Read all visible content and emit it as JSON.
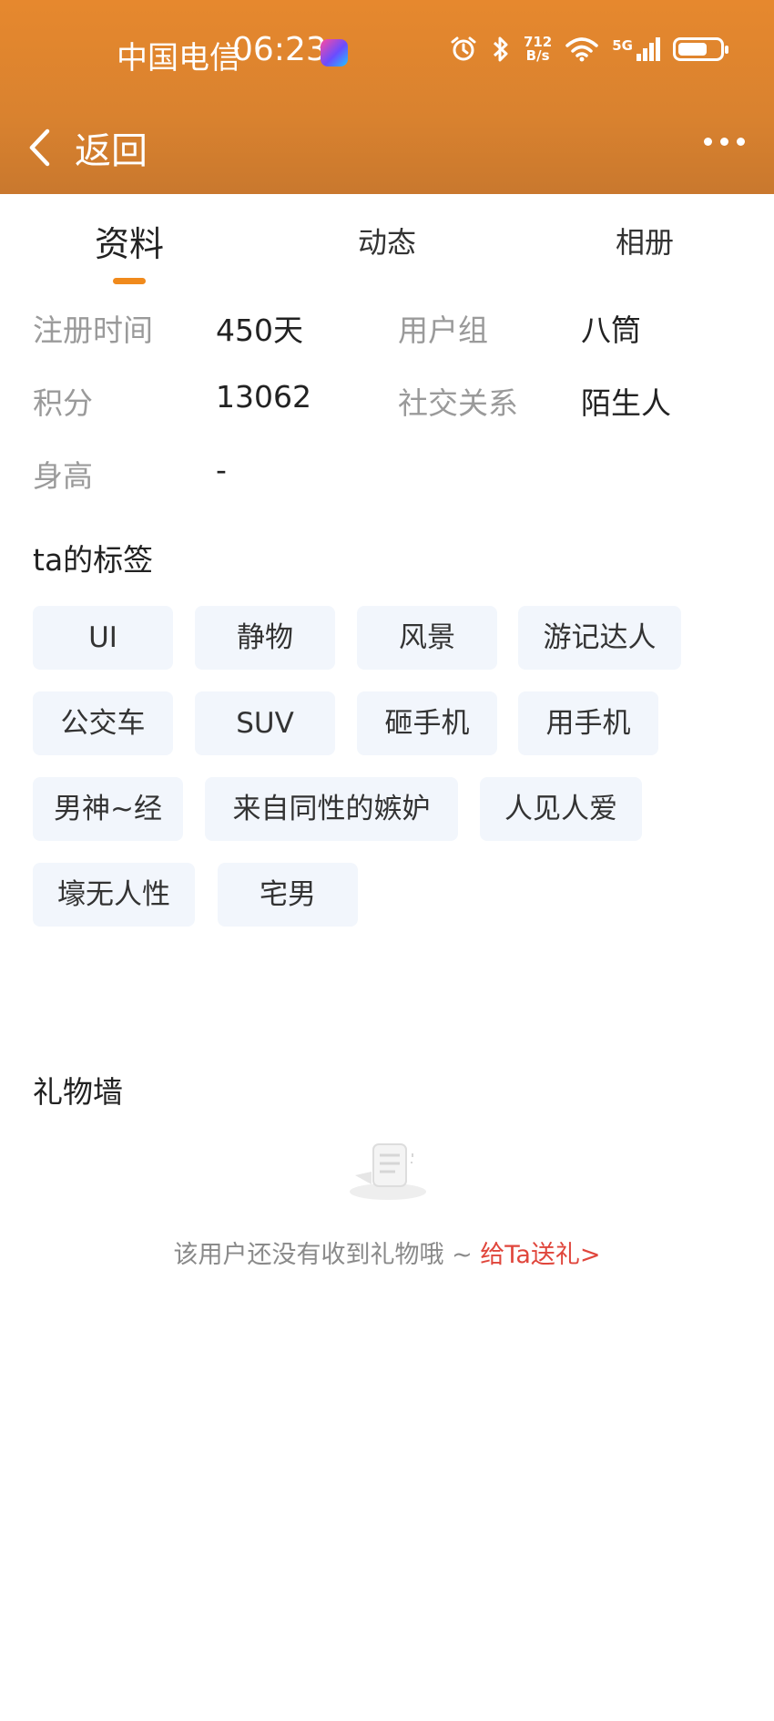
{
  "status_bar": {
    "carrier": "中国电信",
    "time": "06:23",
    "net_speed_value": "712",
    "net_speed_unit": "B/s",
    "network_type": "5G",
    "battery_level_percent": 70
  },
  "nav": {
    "back_label": "返回"
  },
  "tabs": [
    {
      "label": "资料",
      "active": true
    },
    {
      "label": "动态",
      "active": false
    },
    {
      "label": "相册",
      "active": false
    }
  ],
  "profile": {
    "register_label": "注册时间",
    "register_value": "450天",
    "group_label": "用户组",
    "group_value": "八筒",
    "points_label": "积分",
    "points_value": "13062",
    "relation_label": "社交关系",
    "relation_value": "陌生人",
    "height_label": "身高",
    "height_value": "-"
  },
  "tags_section": {
    "title": "ta的标签",
    "tags": [
      "UI",
      "静物",
      "风景",
      "游记达人",
      "公交车",
      "SUV",
      "砸手机",
      "用手机",
      "男神~经",
      "来自同性的嫉妒",
      "人见人爱",
      "壕无人性",
      "宅男"
    ]
  },
  "gift_wall": {
    "title": "礼物墙",
    "empty_text": "该用户还没有收到礼物哦 ~ ",
    "send_gift_link": "给Ta送礼>"
  },
  "colors": {
    "header_orange": "#d9822f",
    "tab_indicator": "#f08a1c",
    "tag_bg": "#f2f6fc",
    "link_red": "#e0463c",
    "label_gray": "#9a9a9a"
  }
}
